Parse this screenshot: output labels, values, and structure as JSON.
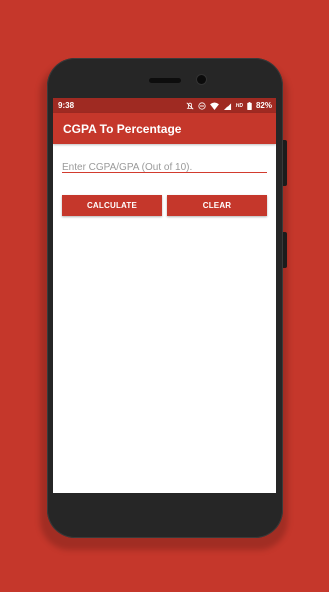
{
  "colors": {
    "background": "#c5372b",
    "status_bar": "#9f2a22",
    "app_bar": "#c5372b",
    "accent": "#d23b2e",
    "phone_body": "#262626"
  },
  "status_bar": {
    "time": "9:38",
    "icons": [
      "mute-icon",
      "do-not-disturb-icon",
      "wifi-icon",
      "hd-signal-icon",
      "battery-icon"
    ],
    "hd_label": "HD",
    "battery": "82%"
  },
  "app_bar": {
    "title": "CGPA To Percentage"
  },
  "form": {
    "input_placeholder": "Enter CGPA/GPA (Out of 10).",
    "input_value": "",
    "calculate_label": "CALCULATE",
    "clear_label": "CLEAR"
  }
}
